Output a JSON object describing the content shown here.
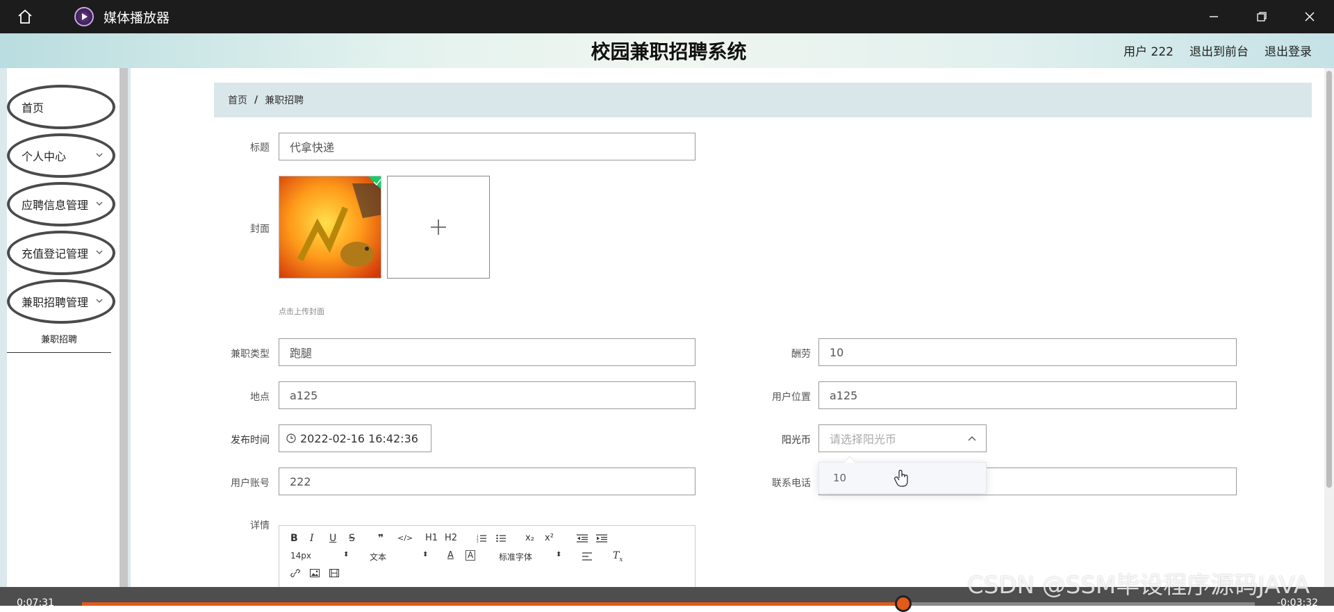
{
  "window": {
    "app_title": "媒体播放器",
    "icons": {
      "home": "home-icon",
      "app": "media-player-icon",
      "minimize": "minimize-icon",
      "restore": "restore-icon",
      "close": "close-icon"
    }
  },
  "header": {
    "system_title": "校园兼职招聘系统",
    "user_label": "用户 222",
    "exit_front": "退出到前台",
    "logout": "退出登录"
  },
  "sidebar": {
    "items": [
      {
        "label": "首页",
        "has_chevron": false
      },
      {
        "label": "个人中心",
        "has_chevron": true
      },
      {
        "label": "应聘信息管理",
        "has_chevron": true
      },
      {
        "label": "充值登记管理",
        "has_chevron": true
      },
      {
        "label": "兼职招聘管理",
        "has_chevron": true
      }
    ],
    "submenu_active": "兼职招聘"
  },
  "breadcrumb": {
    "home": "首页",
    "separator": "/",
    "current": "兼职招聘"
  },
  "form": {
    "title_label": "标题",
    "title_value": "代拿快递",
    "cover_label": "封面",
    "cover_hint": "点击上传封面",
    "type_label": "兼职类型",
    "type_value": "跑腿",
    "pay_label": "酬劳",
    "pay_value": "10",
    "place_label": "地点",
    "place_value": "a125",
    "user_pos_label": "用户位置",
    "user_pos_value": "a125",
    "time_label": "发布时间",
    "time_value": "2022-02-16 16:42:36",
    "coin_label": "阳光币",
    "coin_placeholder": "请选择阳光币",
    "coin_options": [
      "10"
    ],
    "account_label": "用户账号",
    "account_value": "222",
    "phone_label": "联系电话",
    "phone_value": "",
    "detail_label": "详情"
  },
  "editor": {
    "toolbar_row1": [
      "B",
      "I",
      "U",
      "S",
      "❞",
      "</>",
      "H1",
      "H2",
      "ol",
      "ul",
      "x₂",
      "x²",
      "outdent",
      "indent"
    ],
    "font_size": "14px",
    "text_style": "文本",
    "font_family": "标准字体"
  },
  "player": {
    "elapsed": "0:07:31",
    "remaining": "-0:03:32",
    "progress": 0.7
  },
  "watermark": "CSDN @SSM毕设程序源码JAVA"
}
